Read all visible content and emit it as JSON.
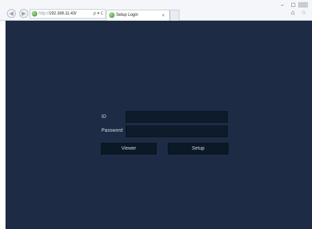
{
  "browser": {
    "back_icon": "back-arrow-icon",
    "forward_icon": "forward-arrow-icon",
    "address": {
      "protocol": "http://",
      "host": "192.168.11.43/"
    },
    "address_tools": "ρ ▾ C",
    "tab": {
      "title": "Setup Login",
      "close": "×"
    },
    "window_controls": "‒ □",
    "browser_icons": "⌂ ☆"
  },
  "page": {
    "id_label": "ID",
    "password_label": "Password",
    "id_value": "",
    "password_value": "",
    "viewer_button": "Viewer",
    "setup_button": "Setup"
  }
}
